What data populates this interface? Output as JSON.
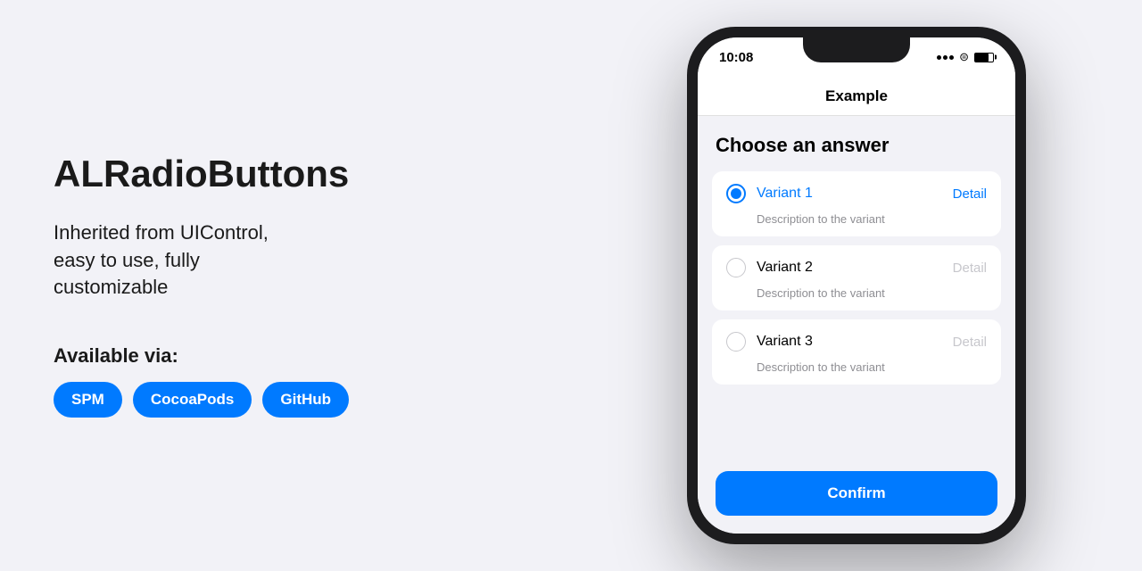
{
  "page": {
    "background": "#f2f2f7"
  },
  "left": {
    "title": "ALRadioButtons",
    "description": "Inherited from UIControl,\neasy to use, fully\ncustomizable",
    "available_label": "Available via:",
    "badges": [
      {
        "id": "spm",
        "label": "SPM"
      },
      {
        "id": "cocoapods",
        "label": "CocoaPods"
      },
      {
        "id": "github",
        "label": "GitHub"
      }
    ]
  },
  "phone": {
    "status_bar": {
      "time": "10:08",
      "icons": "... ≈ 🔋"
    },
    "nav_title": "Example",
    "section_title": "Choose an answer",
    "options": [
      {
        "id": "variant1",
        "label": "Variant 1",
        "detail": "Detail",
        "description": "Description to the variant",
        "selected": true
      },
      {
        "id": "variant2",
        "label": "Variant 2",
        "detail": "Detail",
        "description": "Description to the variant",
        "selected": false
      },
      {
        "id": "variant3",
        "label": "Variant 3",
        "detail": "Detail",
        "description": "Description to the variant",
        "selected": false
      }
    ],
    "confirm_button": "Confirm"
  }
}
